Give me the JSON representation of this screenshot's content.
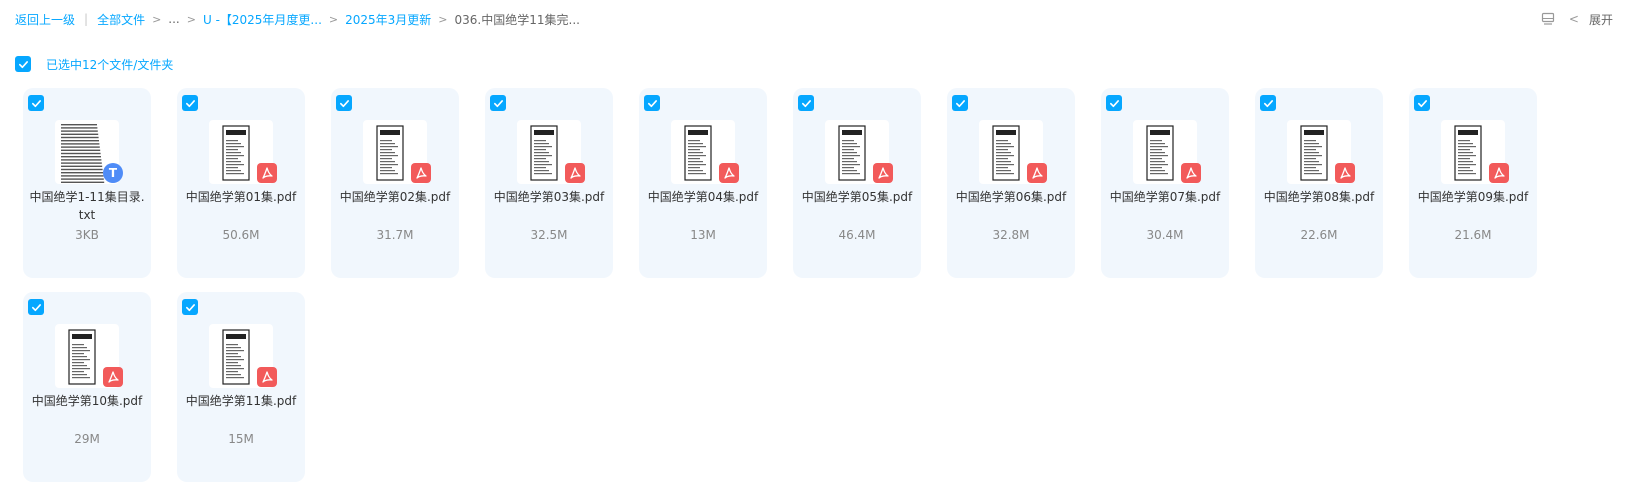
{
  "breadcrumb": {
    "back": "返回上一级",
    "all_files": "全部文件",
    "ellipsis": "...",
    "level1": "U -【2025年月度更...",
    "level2": "2025年3月更新",
    "current": "036.中国绝学11集完..."
  },
  "toolbar": {
    "expand_label": "展开"
  },
  "selection": {
    "label": "已选中12个文件/文件夹"
  },
  "colors": {
    "accent": "#06a7ff",
    "card_bg": "#f1f7fd",
    "pdf_badge": "#f25a5a",
    "txt_badge": "#4f8cf7"
  },
  "files": [
    {
      "name": "中国绝学1-11集目录.txt",
      "size": "3KB",
      "type": "txt",
      "icon": "txt-icon",
      "badge_letter": "T"
    },
    {
      "name": "中国绝学第01集.pdf",
      "size": "50.6M",
      "type": "pdf",
      "icon": "pdf-icon"
    },
    {
      "name": "中国绝学第02集.pdf",
      "size": "31.7M",
      "type": "pdf",
      "icon": "pdf-icon"
    },
    {
      "name": "中国绝学第03集.pdf",
      "size": "32.5M",
      "type": "pdf",
      "icon": "pdf-icon"
    },
    {
      "name": "中国绝学第04集.pdf",
      "size": "13M",
      "type": "pdf",
      "icon": "pdf-icon"
    },
    {
      "name": "中国绝学第05集.pdf",
      "size": "46.4M",
      "type": "pdf",
      "icon": "pdf-icon"
    },
    {
      "name": "中国绝学第06集.pdf",
      "size": "32.8M",
      "type": "pdf",
      "icon": "pdf-icon"
    },
    {
      "name": "中国绝学第07集.pdf",
      "size": "30.4M",
      "type": "pdf",
      "icon": "pdf-icon"
    },
    {
      "name": "中国绝学第08集.pdf",
      "size": "22.6M",
      "type": "pdf",
      "icon": "pdf-icon"
    },
    {
      "name": "中国绝学第09集.pdf",
      "size": "21.6M",
      "type": "pdf",
      "icon": "pdf-icon"
    },
    {
      "name": "中国绝学第10集.pdf",
      "size": "29M",
      "type": "pdf",
      "icon": "pdf-icon"
    },
    {
      "name": "中国绝学第11集.pdf",
      "size": "15M",
      "type": "pdf",
      "icon": "pdf-icon"
    }
  ]
}
